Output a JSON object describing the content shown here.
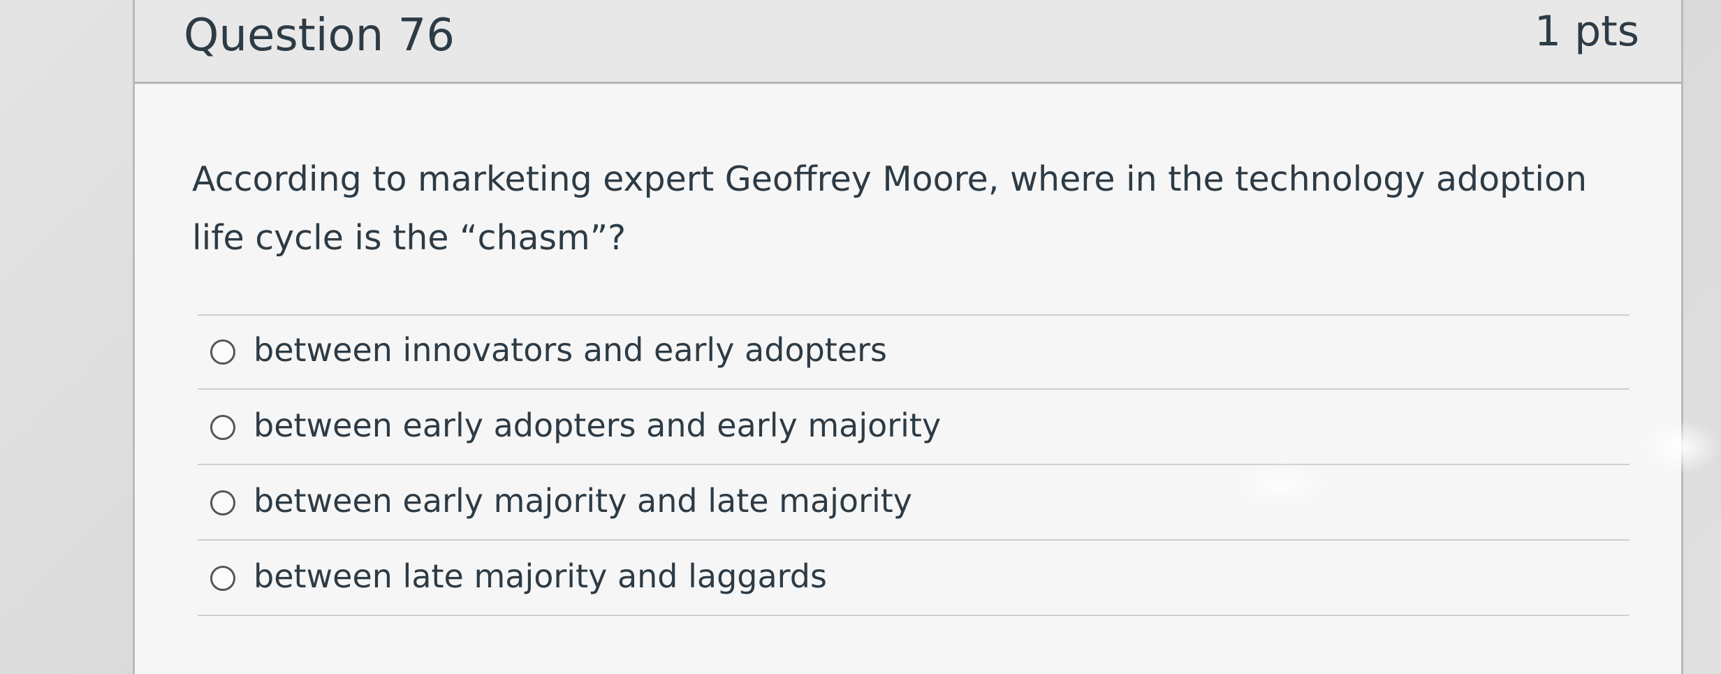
{
  "question": {
    "title": "Question 76",
    "points": "1 pts",
    "text": "According to marketing expert Geoffrey Moore, where in the technology adoption life cycle is the “chasm”?",
    "answers": [
      {
        "label": "between innovators and early adopters",
        "selected": false
      },
      {
        "label": "between early adopters and early majority",
        "selected": false
      },
      {
        "label": "between early majority and late majority",
        "selected": false
      },
      {
        "label": "between late majority and laggards",
        "selected": false
      }
    ]
  },
  "colors": {
    "text": "#2d3b45",
    "header_bg": "#e8e8e8",
    "card_bg": "#f6f6f6",
    "border": "#b5b5b5"
  }
}
